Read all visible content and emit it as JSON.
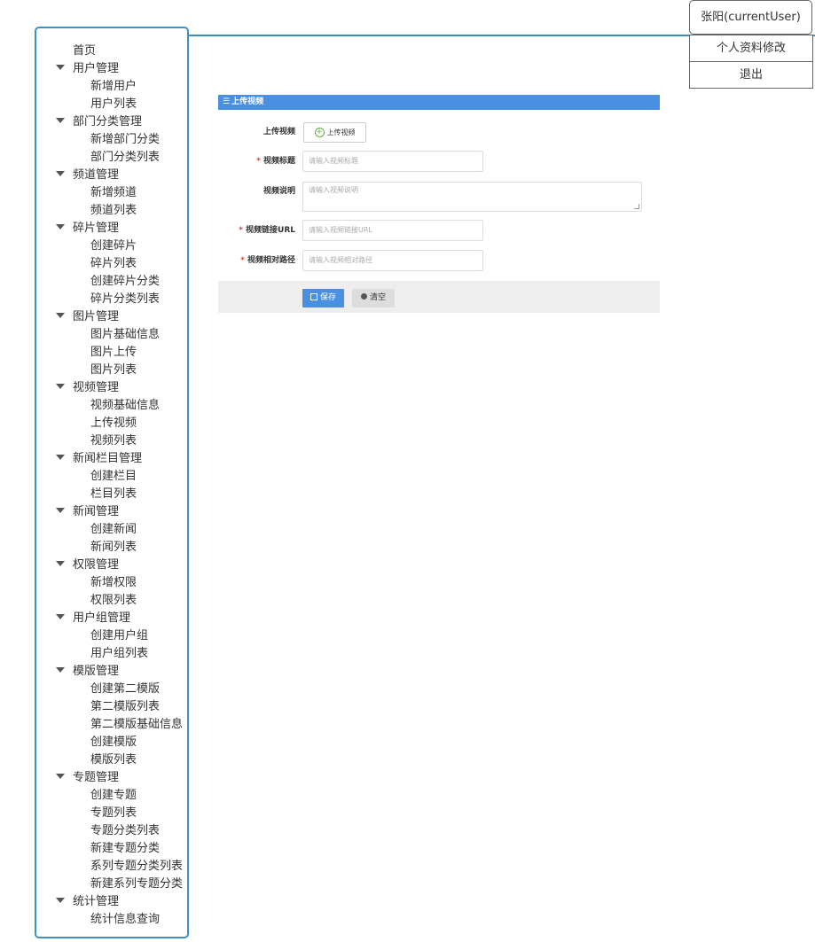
{
  "header": {
    "user_label": "张阳(currentUser)",
    "menu": [
      "个人资料修改",
      "退出"
    ]
  },
  "sidebar": {
    "home": "首页",
    "groups": [
      {
        "label": "用户管理",
        "items": [
          "新增用户",
          "用户列表"
        ]
      },
      {
        "label": "部门分类管理",
        "items": [
          "新增部门分类",
          "部门分类列表"
        ]
      },
      {
        "label": "频道管理",
        "items": [
          "新增频道",
          "频道列表"
        ]
      },
      {
        "label": "碎片管理",
        "items": [
          "创建碎片",
          "碎片列表",
          "创建碎片分类",
          "碎片分类列表"
        ]
      },
      {
        "label": "图片管理",
        "items": [
          "图片基础信息",
          "图片上传",
          "图片列表"
        ]
      },
      {
        "label": "视频管理",
        "items": [
          "视频基础信息",
          "上传视频",
          "视频列表"
        ]
      },
      {
        "label": "新闻栏目管理",
        "items": [
          "创建栏目",
          "栏目列表"
        ]
      },
      {
        "label": "新闻管理",
        "items": [
          "创建新闻",
          "新闻列表"
        ]
      },
      {
        "label": "权限管理",
        "items": [
          "新增权限",
          "权限列表"
        ]
      },
      {
        "label": "用户组管理",
        "items": [
          "创建用户组",
          "用户组列表"
        ]
      },
      {
        "label": "模版管理",
        "items": [
          "创建第二模版",
          "第二模版列表",
          "第二模版基础信息",
          "创建模版",
          "模版列表"
        ]
      },
      {
        "label": "专题管理",
        "items": [
          "创建专题",
          "专题列表",
          "专题分类列表",
          "新建专题分类",
          "系列专题分类列表",
          "新建系列专题分类"
        ]
      },
      {
        "label": "统计管理",
        "items": [
          "统计信息查询"
        ]
      }
    ]
  },
  "form": {
    "title": "上传视频",
    "upload_label": "上传视频",
    "upload_button": "上传视频",
    "title_label": "视频标题",
    "title_placeholder": "请输入视频标题",
    "desc_label": "视频说明",
    "desc_placeholder": "请输入视频说明",
    "url_label": "视频链接URL",
    "url_placeholder": "请输入视频链接URL",
    "path_label": "视频相对路径",
    "path_placeholder": "请输入视频相对路径",
    "required_mark": "*",
    "save_button": "保存",
    "clear_button": "清空"
  },
  "colors": {
    "accent": "#4a90e2",
    "frame": "#3f8fc8",
    "required": "#e33333"
  }
}
